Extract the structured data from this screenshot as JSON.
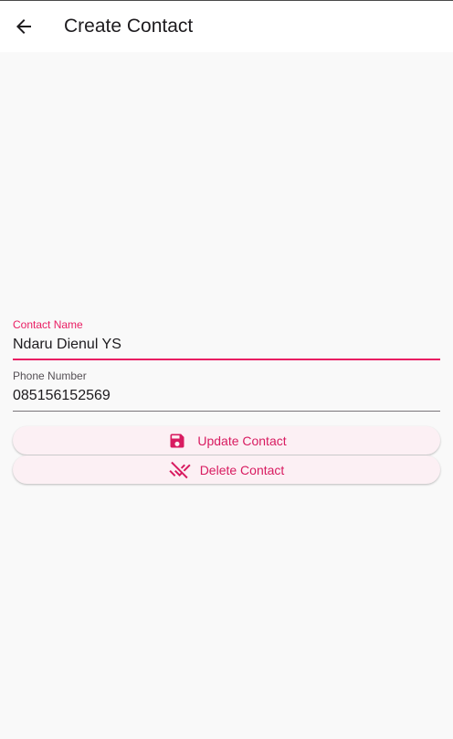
{
  "app_bar": {
    "title": "Create Contact",
    "back_icon": "arrow-back-icon"
  },
  "form": {
    "name_field": {
      "label": "Contact Name",
      "value": "Ndaru Dienul YS",
      "state": "focused"
    },
    "phone_field": {
      "label": "Phone Number",
      "value": "085156152569"
    }
  },
  "actions": {
    "update": {
      "label": "Update Contact",
      "icon": "save-icon"
    },
    "delete": {
      "label": "Delete Contact",
      "icon": "remove-done-icon"
    }
  },
  "colors": {
    "accent": "#e91e63",
    "button_bg": "#fcf0f4",
    "background": "#f9f9f9"
  }
}
